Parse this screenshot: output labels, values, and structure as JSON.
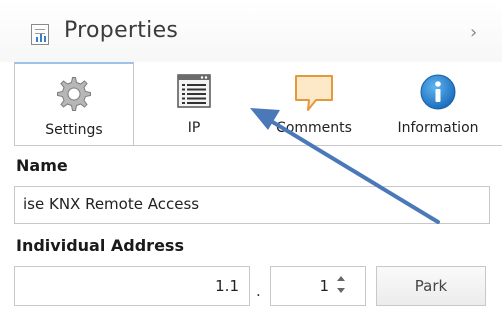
{
  "panel": {
    "title": "Properties",
    "collapse_icon": "chevron-right-icon"
  },
  "tabs": [
    {
      "label": "Settings",
      "icon": "gear-icon",
      "active": true
    },
    {
      "label": "IP",
      "icon": "list-window-icon",
      "active": false
    },
    {
      "label": "Comments",
      "icon": "speech-bubble-icon",
      "active": false
    },
    {
      "label": "Information",
      "icon": "info-icon",
      "active": false
    }
  ],
  "form": {
    "name_label": "Name",
    "name_value": "ise KNX Remote Access",
    "address_label": "Individual Address",
    "address_value": "1.1",
    "separator": ".",
    "device_value": "1",
    "park_label": "Park"
  },
  "annotation": {
    "arrow_color": "#4a78b8"
  },
  "colors": {
    "accent": "#3a7fc4",
    "info_blue": "#1e84d6",
    "comment_fill": "#fde9c7",
    "comment_stroke": "#e39a3c"
  }
}
